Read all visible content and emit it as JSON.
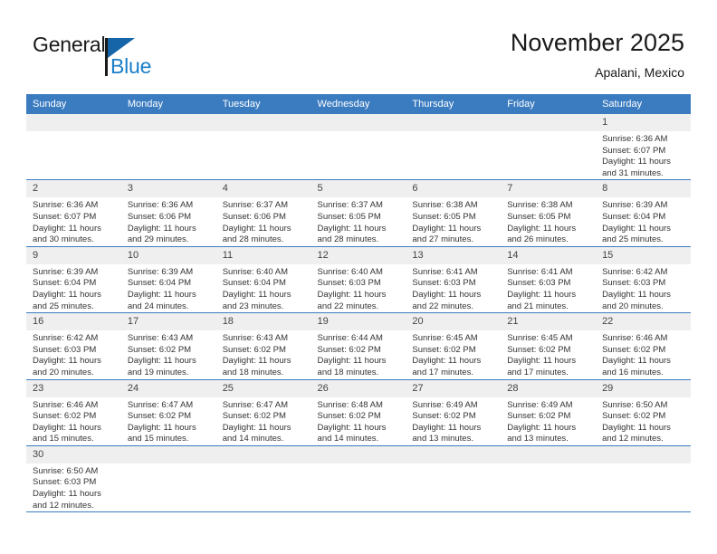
{
  "brand": {
    "name_part1": "General",
    "name_part2": "Blue",
    "flag_color": "#1565a8",
    "blue_text_color": "#1a7ec8"
  },
  "header": {
    "title": "November 2025",
    "subtitle": "Apalani, Mexico",
    "accent_color": "#3b7cc0"
  },
  "calendar": {
    "weekday_headers": [
      "Sunday",
      "Monday",
      "Tuesday",
      "Wednesday",
      "Thursday",
      "Friday",
      "Saturday"
    ],
    "labels": {
      "sunrise": "Sunrise:",
      "sunset": "Sunset:",
      "daylight": "Daylight:"
    },
    "weeks": [
      [
        {
          "day": "",
          "empty": true
        },
        {
          "day": "",
          "empty": true
        },
        {
          "day": "",
          "empty": true
        },
        {
          "day": "",
          "empty": true
        },
        {
          "day": "",
          "empty": true
        },
        {
          "day": "",
          "empty": true
        },
        {
          "day": "1",
          "sunrise": "Sunrise: 6:36 AM",
          "sunset": "Sunset: 6:07 PM",
          "daylight1": "Daylight: 11 hours",
          "daylight2": "and 31 minutes."
        }
      ],
      [
        {
          "day": "2",
          "sunrise": "Sunrise: 6:36 AM",
          "sunset": "Sunset: 6:07 PM",
          "daylight1": "Daylight: 11 hours",
          "daylight2": "and 30 minutes."
        },
        {
          "day": "3",
          "sunrise": "Sunrise: 6:36 AM",
          "sunset": "Sunset: 6:06 PM",
          "daylight1": "Daylight: 11 hours",
          "daylight2": "and 29 minutes."
        },
        {
          "day": "4",
          "sunrise": "Sunrise: 6:37 AM",
          "sunset": "Sunset: 6:06 PM",
          "daylight1": "Daylight: 11 hours",
          "daylight2": "and 28 minutes."
        },
        {
          "day": "5",
          "sunrise": "Sunrise: 6:37 AM",
          "sunset": "Sunset: 6:05 PM",
          "daylight1": "Daylight: 11 hours",
          "daylight2": "and 28 minutes."
        },
        {
          "day": "6",
          "sunrise": "Sunrise: 6:38 AM",
          "sunset": "Sunset: 6:05 PM",
          "daylight1": "Daylight: 11 hours",
          "daylight2": "and 27 minutes."
        },
        {
          "day": "7",
          "sunrise": "Sunrise: 6:38 AM",
          "sunset": "Sunset: 6:05 PM",
          "daylight1": "Daylight: 11 hours",
          "daylight2": "and 26 minutes."
        },
        {
          "day": "8",
          "sunrise": "Sunrise: 6:39 AM",
          "sunset": "Sunset: 6:04 PM",
          "daylight1": "Daylight: 11 hours",
          "daylight2": "and 25 minutes."
        }
      ],
      [
        {
          "day": "9",
          "sunrise": "Sunrise: 6:39 AM",
          "sunset": "Sunset: 6:04 PM",
          "daylight1": "Daylight: 11 hours",
          "daylight2": "and 25 minutes."
        },
        {
          "day": "10",
          "sunrise": "Sunrise: 6:39 AM",
          "sunset": "Sunset: 6:04 PM",
          "daylight1": "Daylight: 11 hours",
          "daylight2": "and 24 minutes."
        },
        {
          "day": "11",
          "sunrise": "Sunrise: 6:40 AM",
          "sunset": "Sunset: 6:04 PM",
          "daylight1": "Daylight: 11 hours",
          "daylight2": "and 23 minutes."
        },
        {
          "day": "12",
          "sunrise": "Sunrise: 6:40 AM",
          "sunset": "Sunset: 6:03 PM",
          "daylight1": "Daylight: 11 hours",
          "daylight2": "and 22 minutes."
        },
        {
          "day": "13",
          "sunrise": "Sunrise: 6:41 AM",
          "sunset": "Sunset: 6:03 PM",
          "daylight1": "Daylight: 11 hours",
          "daylight2": "and 22 minutes."
        },
        {
          "day": "14",
          "sunrise": "Sunrise: 6:41 AM",
          "sunset": "Sunset: 6:03 PM",
          "daylight1": "Daylight: 11 hours",
          "daylight2": "and 21 minutes."
        },
        {
          "day": "15",
          "sunrise": "Sunrise: 6:42 AM",
          "sunset": "Sunset: 6:03 PM",
          "daylight1": "Daylight: 11 hours",
          "daylight2": "and 20 minutes."
        }
      ],
      [
        {
          "day": "16",
          "sunrise": "Sunrise: 6:42 AM",
          "sunset": "Sunset: 6:03 PM",
          "daylight1": "Daylight: 11 hours",
          "daylight2": "and 20 minutes."
        },
        {
          "day": "17",
          "sunrise": "Sunrise: 6:43 AM",
          "sunset": "Sunset: 6:02 PM",
          "daylight1": "Daylight: 11 hours",
          "daylight2": "and 19 minutes."
        },
        {
          "day": "18",
          "sunrise": "Sunrise: 6:43 AM",
          "sunset": "Sunset: 6:02 PM",
          "daylight1": "Daylight: 11 hours",
          "daylight2": "and 18 minutes."
        },
        {
          "day": "19",
          "sunrise": "Sunrise: 6:44 AM",
          "sunset": "Sunset: 6:02 PM",
          "daylight1": "Daylight: 11 hours",
          "daylight2": "and 18 minutes."
        },
        {
          "day": "20",
          "sunrise": "Sunrise: 6:45 AM",
          "sunset": "Sunset: 6:02 PM",
          "daylight1": "Daylight: 11 hours",
          "daylight2": "and 17 minutes."
        },
        {
          "day": "21",
          "sunrise": "Sunrise: 6:45 AM",
          "sunset": "Sunset: 6:02 PM",
          "daylight1": "Daylight: 11 hours",
          "daylight2": "and 17 minutes."
        },
        {
          "day": "22",
          "sunrise": "Sunrise: 6:46 AM",
          "sunset": "Sunset: 6:02 PM",
          "daylight1": "Daylight: 11 hours",
          "daylight2": "and 16 minutes."
        }
      ],
      [
        {
          "day": "23",
          "sunrise": "Sunrise: 6:46 AM",
          "sunset": "Sunset: 6:02 PM",
          "daylight1": "Daylight: 11 hours",
          "daylight2": "and 15 minutes."
        },
        {
          "day": "24",
          "sunrise": "Sunrise: 6:47 AM",
          "sunset": "Sunset: 6:02 PM",
          "daylight1": "Daylight: 11 hours",
          "daylight2": "and 15 minutes."
        },
        {
          "day": "25",
          "sunrise": "Sunrise: 6:47 AM",
          "sunset": "Sunset: 6:02 PM",
          "daylight1": "Daylight: 11 hours",
          "daylight2": "and 14 minutes."
        },
        {
          "day": "26",
          "sunrise": "Sunrise: 6:48 AM",
          "sunset": "Sunset: 6:02 PM",
          "daylight1": "Daylight: 11 hours",
          "daylight2": "and 14 minutes."
        },
        {
          "day": "27",
          "sunrise": "Sunrise: 6:49 AM",
          "sunset": "Sunset: 6:02 PM",
          "daylight1": "Daylight: 11 hours",
          "daylight2": "and 13 minutes."
        },
        {
          "day": "28",
          "sunrise": "Sunrise: 6:49 AM",
          "sunset": "Sunset: 6:02 PM",
          "daylight1": "Daylight: 11 hours",
          "daylight2": "and 13 minutes."
        },
        {
          "day": "29",
          "sunrise": "Sunrise: 6:50 AM",
          "sunset": "Sunset: 6:02 PM",
          "daylight1": "Daylight: 11 hours",
          "daylight2": "and 12 minutes."
        }
      ],
      [
        {
          "day": "30",
          "sunrise": "Sunrise: 6:50 AM",
          "sunset": "Sunset: 6:03 PM",
          "daylight1": "Daylight: 11 hours",
          "daylight2": "and 12 minutes."
        },
        {
          "day": "",
          "empty": true,
          "blank": true
        },
        {
          "day": "",
          "empty": true,
          "blank": true
        },
        {
          "day": "",
          "empty": true,
          "blank": true
        },
        {
          "day": "",
          "empty": true,
          "blank": true
        },
        {
          "day": "",
          "empty": true,
          "blank": true
        },
        {
          "day": "",
          "empty": true,
          "blank": true
        }
      ]
    ]
  }
}
